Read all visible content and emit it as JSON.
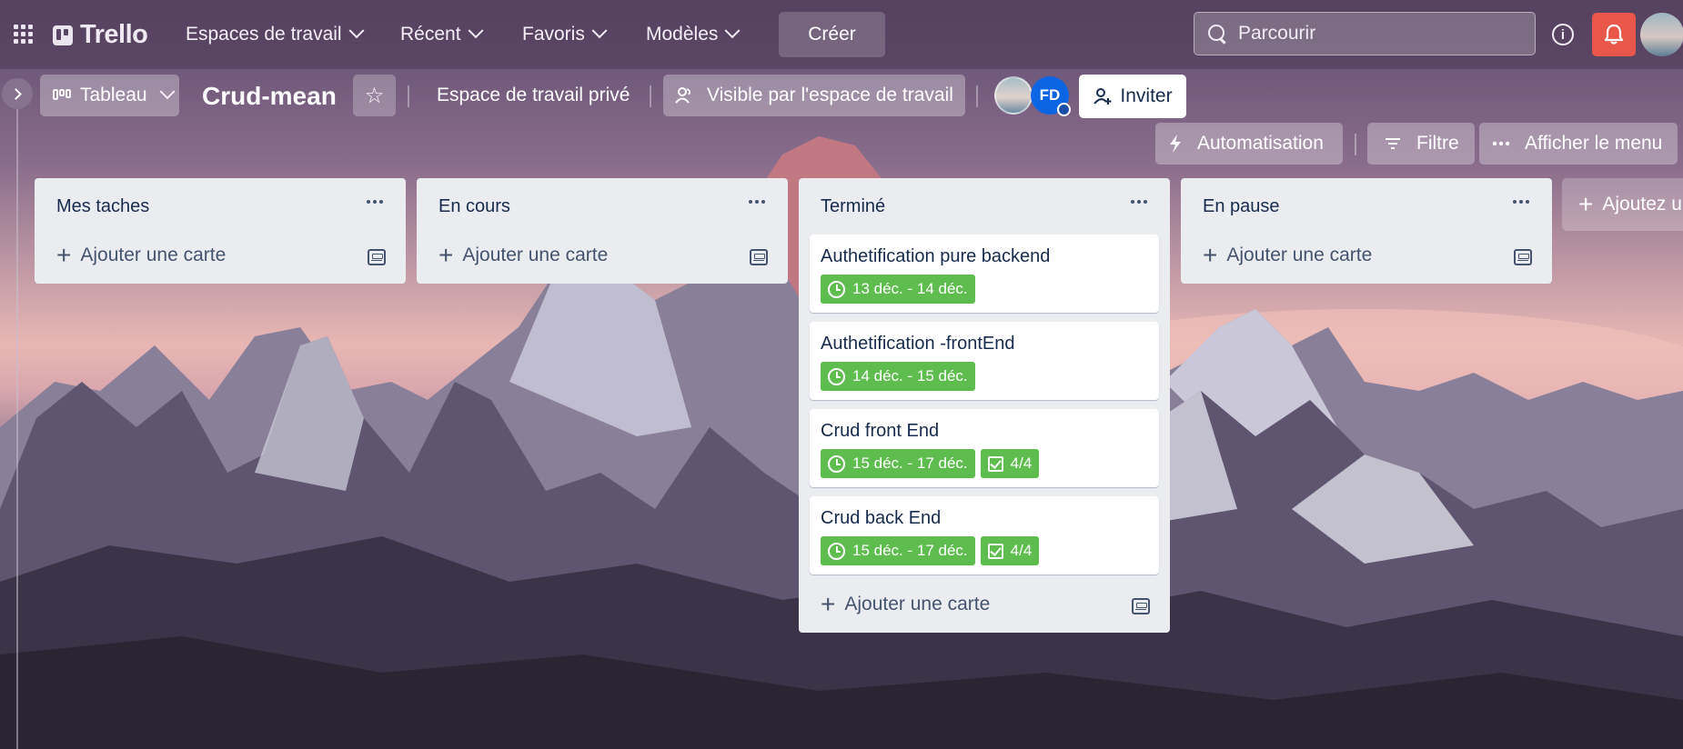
{
  "topbar": {
    "logo_text": "Trello",
    "nav": [
      {
        "label": "Espaces de travail"
      },
      {
        "label": "Récent"
      },
      {
        "label": "Favoris"
      },
      {
        "label": "Modèles"
      }
    ],
    "create_label": "Créer",
    "search_placeholder": "Parcourir",
    "notification_color": "#e8574a"
  },
  "board": {
    "view_label": "Tableau",
    "title": "Crud-mean",
    "workspace_label": "Espace de travail privé",
    "visibility_label": "Visible par l'espace de travail",
    "members": [
      {
        "initials": ""
      },
      {
        "initials": "FD"
      }
    ],
    "invite_label": "Inviter",
    "automation_label": "Automatisation",
    "filter_label": "Filtre",
    "menu_label": "Afficher le menu",
    "add_list_label": "Ajoutez u"
  },
  "lists": [
    {
      "title": "Mes taches",
      "add_card_label": "Ajouter une carte",
      "cards": []
    },
    {
      "title": "En cours",
      "add_card_label": "Ajouter une carte",
      "cards": []
    },
    {
      "title": "Terminé",
      "add_card_label": "Ajouter une carte",
      "cards": [
        {
          "title": "Authetification pure backend",
          "dates": "13 déc. - 14 déc.",
          "checklist": null
        },
        {
          "title": "Authetification -frontEnd",
          "dates": "14 déc. - 15 déc.",
          "checklist": null
        },
        {
          "title": "Crud front End",
          "dates": "15 déc. - 17 déc.",
          "checklist": "4/4"
        },
        {
          "title": "Crud back End",
          "dates": "15 déc. - 17 déc.",
          "checklist": "4/4"
        }
      ]
    },
    {
      "title": "En pause",
      "add_card_label": "Ajouter une carte",
      "cards": []
    }
  ],
  "colors": {
    "badge_complete": "#5fbd4f",
    "list_bg": "#ebecf0",
    "member_fd": "#0c66e4"
  }
}
